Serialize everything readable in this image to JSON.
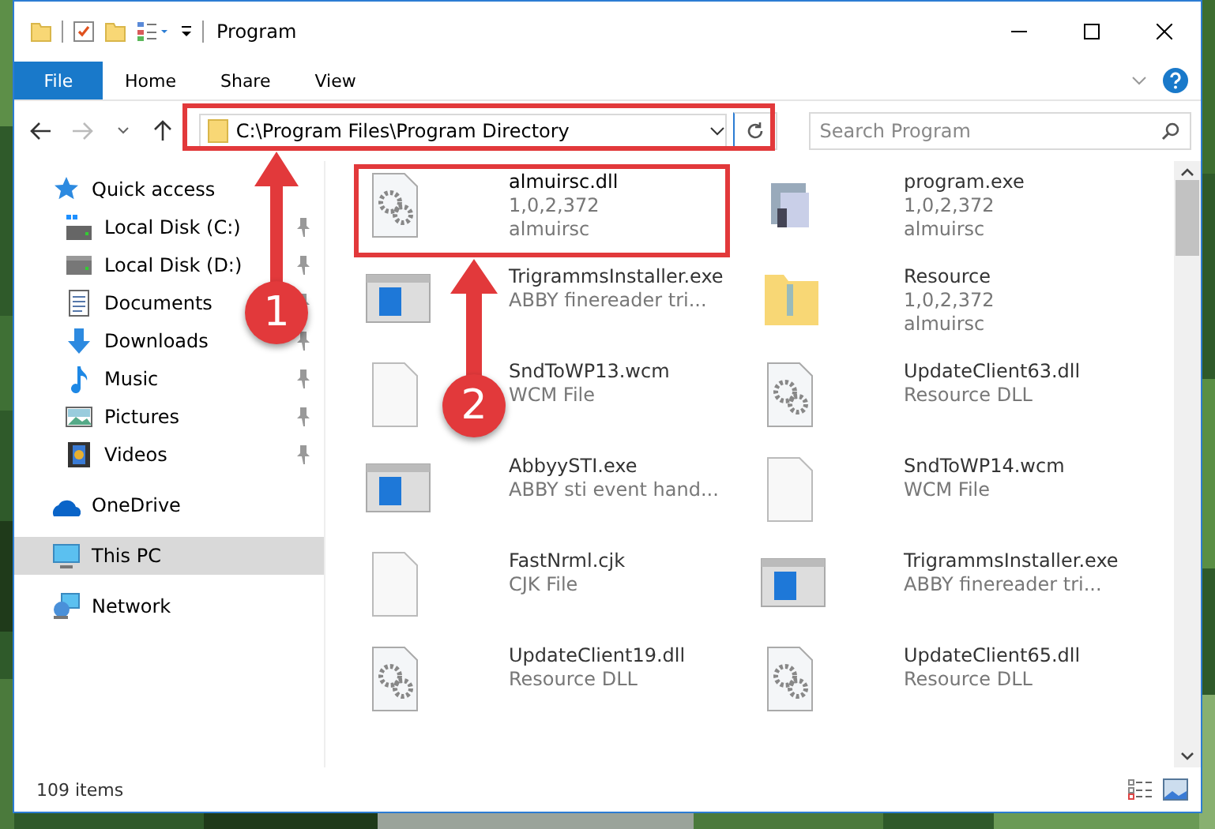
{
  "window": {
    "title": "Program"
  },
  "ribbon": {
    "file_button": "File",
    "tabs": [
      "Home",
      "Share",
      "View"
    ]
  },
  "address": {
    "path": "C:\\Program Files\\Program Directory"
  },
  "search": {
    "placeholder": "Search Program"
  },
  "nav": [
    {
      "label": "Quick access",
      "kind": "star",
      "selected": false,
      "children": [
        {
          "label": "Local Disk (C:)",
          "kind": "windisk",
          "pinned": true,
          "selected": false
        },
        {
          "label": "Local Disk (D:)",
          "kind": "disk",
          "pinned": true,
          "selected": false
        },
        {
          "label": "Documents",
          "kind": "document",
          "pinned": true,
          "selected": false
        },
        {
          "label": "Downloads",
          "kind": "download",
          "pinned": true,
          "selected": false
        },
        {
          "label": "Music",
          "kind": "music",
          "pinned": true,
          "selected": false
        },
        {
          "label": "Pictures",
          "kind": "pictures",
          "pinned": true,
          "selected": false
        },
        {
          "label": "Videos",
          "kind": "video",
          "pinned": true,
          "selected": false
        }
      ]
    },
    {
      "label": "OneDrive",
      "kind": "cloud",
      "selected": false
    },
    {
      "label": "This PC",
      "kind": "computer",
      "selected": true
    },
    {
      "label": "Network",
      "kind": "network",
      "selected": false
    }
  ],
  "files": [
    {
      "name": "almuirsc.dll",
      "details": [
        "1,0,2,372",
        "almuirsc"
      ],
      "kind": "dll",
      "highlighted": true
    },
    {
      "name": "program.exe",
      "details": [
        "1,0,2,372",
        "almuirsc"
      ],
      "kind": "setup",
      "highlighted": false
    },
    {
      "name": "TrigrammsInstaller.exe",
      "details": [
        "ABBY finereader tri..."
      ],
      "kind": "app",
      "highlighted": false
    },
    {
      "name": "Resource",
      "details": [
        "1,0,2,372",
        "almuirsc"
      ],
      "kind": "folder",
      "highlighted": false
    },
    {
      "name": "SndToWP13.wcm",
      "details": [
        "WCM File"
      ],
      "kind": "file",
      "highlighted": false
    },
    {
      "name": "UpdateClient63.dll",
      "details": [
        "Resource DLL"
      ],
      "kind": "dll",
      "highlighted": false
    },
    {
      "name": "AbbyySTI.exe",
      "details": [
        "ABBY sti event hand..."
      ],
      "kind": "app",
      "highlighted": false
    },
    {
      "name": "SndToWP14.wcm",
      "details": [
        "WCM File"
      ],
      "kind": "file",
      "highlighted": false
    },
    {
      "name": "FastNrml.cjk",
      "details": [
        "CJK File"
      ],
      "kind": "file",
      "highlighted": false
    },
    {
      "name": "TrigrammsInstaller.exe",
      "details": [
        "ABBY finereader tri..."
      ],
      "kind": "app",
      "highlighted": false
    },
    {
      "name": "UpdateClient19.dll",
      "details": [
        "Resource DLL"
      ],
      "kind": "dll",
      "highlighted": false
    },
    {
      "name": "UpdateClient65.dll",
      "details": [
        "Resource DLL"
      ],
      "kind": "dll",
      "highlighted": false
    }
  ],
  "status_bar": {
    "count": "109 items"
  },
  "annotations": [
    {
      "number": "1"
    },
    {
      "number": "2"
    }
  ]
}
